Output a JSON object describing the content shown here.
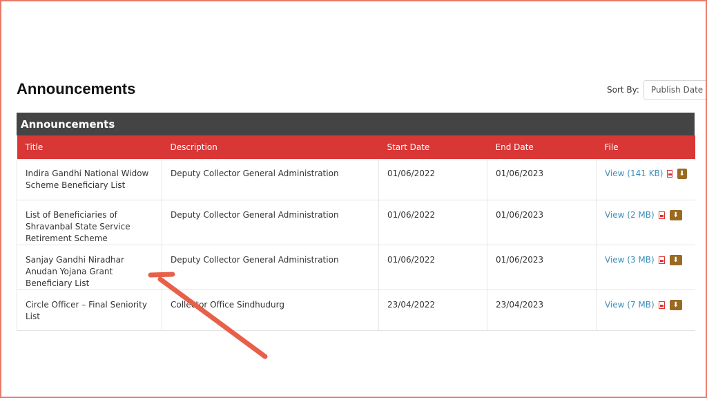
{
  "page": {
    "title": "Announcements"
  },
  "sort": {
    "label": "Sort By:",
    "selected": "Publish Date"
  },
  "panel": {
    "title": "Announcements"
  },
  "table": {
    "headers": [
      "Title",
      "Description",
      "Start Date",
      "End Date",
      "File"
    ],
    "rows": [
      {
        "title": "Indira Gandhi National Widow Scheme Beneficiary List",
        "description": "Deputy Collector General Administration",
        "start": "01/06/2022",
        "end": "01/06/2023",
        "file": "View (141 KB)"
      },
      {
        "title": "List of Beneficiaries of Shravanbal State Service Retirement Scheme",
        "description": "Deputy Collector General Administration",
        "start": "01/06/2022",
        "end": "01/06/2023",
        "file": "View (2 MB)"
      },
      {
        "title": "Sanjay Gandhi Niradhar Anudan Yojana Grant Beneficiary List",
        "description": "Deputy Collector General Administration",
        "start": "01/06/2022",
        "end": "01/06/2023",
        "file": "View (3 MB)"
      },
      {
        "title": "Circle Officer – Final Seniority List",
        "description": "Collector Office Sindhudurg",
        "start": "23/04/2022",
        "end": "23/04/2023",
        "file": "View (7 MB)"
      }
    ]
  },
  "colors": {
    "header_bar": "#444444",
    "table_header": "#d93636",
    "arrow": "#e8604a",
    "link": "#3a8fb8",
    "download": "#9a6a22"
  },
  "icons": {
    "pdf": "pdf-file-icon",
    "download": "download-icon",
    "annotation": "red-arrow-annotation"
  }
}
